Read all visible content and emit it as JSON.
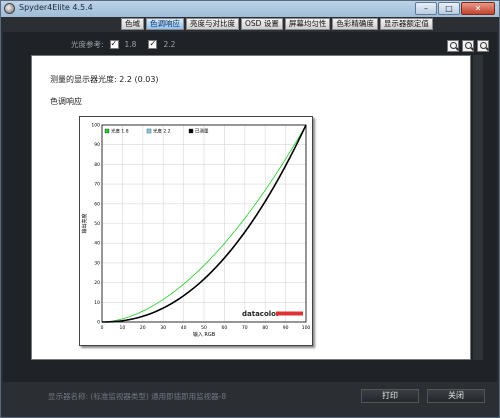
{
  "window": {
    "title": "Spyder4Elite 4.5.4",
    "minimize": "–",
    "maximize": "□",
    "close": "✕"
  },
  "tabs": [
    {
      "label": "色域",
      "active": false
    },
    {
      "label": "色调响应",
      "active": true
    },
    {
      "label": "亮度与对比度",
      "active": false
    },
    {
      "label": "OSD 设置",
      "active": false
    },
    {
      "label": "屏幕均匀性",
      "active": false
    },
    {
      "label": "色彩精确度",
      "active": false
    },
    {
      "label": "显示器额定值",
      "active": false
    }
  ],
  "reference_bar": {
    "label": "光度参考:",
    "options": [
      {
        "label": "1.8",
        "checked": true
      },
      {
        "label": "2.2",
        "checked": true
      }
    ]
  },
  "zoom_icons": [
    "zoom-in-icon",
    "zoom-out-icon",
    "zoom-fit-icon"
  ],
  "report": {
    "gamma_text": "测量的显示器光度:  2.2 (0.03)",
    "section_title": "色调响应"
  },
  "chart_data": {
    "type": "line",
    "title": "",
    "xlabel": "输入 RGB",
    "ylabel": "输出亮度",
    "xlim": [
      0,
      100
    ],
    "ylim": [
      0,
      100
    ],
    "x_ticks": [
      "0",
      "10",
      "20",
      "30",
      "40",
      "50",
      "60",
      "70",
      "80",
      "90",
      "100"
    ],
    "y_ticks": [
      "0",
      "10",
      "20",
      "30",
      "40",
      "50",
      "60",
      "70",
      "80",
      "90",
      "100"
    ],
    "grid": true,
    "legend_position": "top-left",
    "watermark": "datacolor",
    "series": [
      {
        "name": "光度 1.8",
        "color": "#22cc22",
        "gamma": 1.8,
        "x": [
          0,
          10,
          20,
          30,
          40,
          50,
          60,
          70,
          80,
          90,
          100
        ],
        "y": [
          0,
          1.6,
          5.5,
          11.5,
          19.2,
          28.7,
          39.9,
          52.6,
          66.9,
          82.7,
          100
        ]
      },
      {
        "name": "光度 2.2",
        "color": "#7fd4f0",
        "gamma": 2.2,
        "x": [
          0,
          10,
          20,
          30,
          40,
          50,
          60,
          70,
          80,
          90,
          100
        ],
        "y": [
          0,
          0.6,
          2.9,
          7.1,
          13.3,
          21.8,
          32.5,
          45.6,
          61.2,
          79.3,
          100
        ]
      },
      {
        "name": "已测量",
        "color": "#000000",
        "gamma": 2.2,
        "x": [
          0,
          10,
          20,
          30,
          40,
          50,
          60,
          70,
          80,
          90,
          100
        ],
        "y": [
          0,
          0.8,
          3.0,
          7.0,
          13.0,
          21.5,
          32.0,
          45.0,
          60.5,
          78.8,
          100
        ]
      }
    ]
  },
  "footer": {
    "display_name": "显示器名称: (标准监视器类型) 通用即插即用监视器-8",
    "print_label": "打印",
    "close_label": "关闭"
  }
}
